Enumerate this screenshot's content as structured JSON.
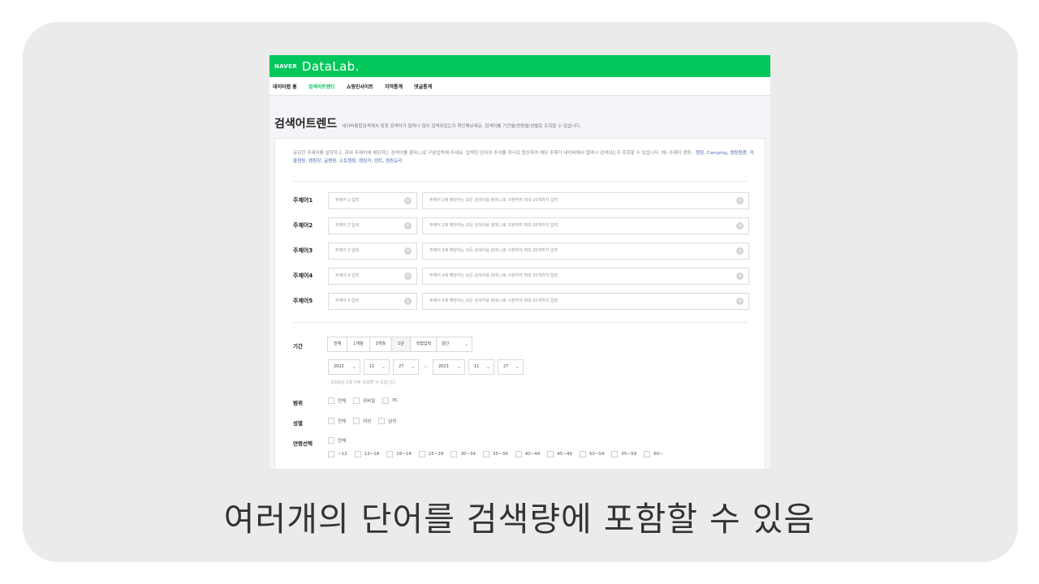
{
  "header": {
    "naver": "NAVER",
    "datalab": "DataLab."
  },
  "nav": [
    {
      "label": "데이터랩 홈"
    },
    {
      "label": "검색어트렌드"
    },
    {
      "label": "쇼핑인사이트"
    },
    {
      "label": "지역통계"
    },
    {
      "label": "댓글통계"
    }
  ],
  "page": {
    "title": "검색어트렌드",
    "desc": "네이버통합검색에서 특정 검색어가 얼마나 많이 검색되었는지 확인해보세요. 검색어를 기간별/연령별/성별로 조회할 수 있습니다.",
    "intro": "궁금한 주제어를 설정하고, 하위 주제어에 해당하는 검색어를 콤마(,)로 구분입력해 주세요. 입력한 단어의 추이를 하나로 합산하여 해당 주제가 네이버에서 얼마나 검색되는지 조회할 수 있습니다. 예) 주제어 캠핑 :",
    "intro_example": "캠핑, Camping, 캠핑용품, 겨울캠핑, 캠핑장, 글램핑, 오토캠핑, 캠핑카, 텐트, 캠핑요리"
  },
  "keywords": [
    {
      "label": "주제어1",
      "placeholder": "주제어 1 입력",
      "sub_placeholder": "주제어 1에 해당하는 모든 검색어를 컴마(,)로 구분하여 최대 20개까지 입력"
    },
    {
      "label": "주제어2",
      "placeholder": "주제어 2 입력",
      "sub_placeholder": "주제어 2에 해당하는 모든 검색어를 컴마(,)로 구분하여 최대 20개까지 입력"
    },
    {
      "label": "주제어3",
      "placeholder": "주제어 3 입력",
      "sub_placeholder": "주제어 3에 해당하는 모든 검색어를 컴마(,)로 구분하여 최대 20개까지 입력"
    },
    {
      "label": "주제어4",
      "placeholder": "주제어 4 입력",
      "sub_placeholder": "주제어 4에 해당하는 모든 검색어를 컴마(,)로 구분하여 최대 20개까지 입력"
    },
    {
      "label": "주제어5",
      "placeholder": "주제어 5 입력",
      "sub_placeholder": "주제어 5에 해당하는 모든 검색어를 컴마(,)로 구분하여 최대 20개까지 입력"
    }
  ],
  "period": {
    "label": "기간",
    "buttons": [
      "전체",
      "1개월",
      "3개월",
      "1년",
      "직접입력"
    ],
    "selected": "1년",
    "unit": "일간",
    "start": {
      "year": "2022",
      "month": "11",
      "day": "27"
    },
    "end": {
      "year": "2023",
      "month": "11",
      "day": "27"
    },
    "tilde": "~",
    "note": "- 2016년 1월 이후 조회할 수 있습니다."
  },
  "scope": {
    "label": "범위",
    "options": [
      "전체",
      "모바일",
      "PC"
    ]
  },
  "gender": {
    "label": "성별",
    "options": [
      "전체",
      "여성",
      "남성"
    ]
  },
  "age": {
    "label": "연령선택",
    "all": "전체",
    "options": [
      "~12",
      "13~18",
      "19~24",
      "25~29",
      "30~34",
      "35~39",
      "40~44",
      "45~49",
      "50~54",
      "55~59",
      "60~"
    ]
  },
  "caption": "여러개의 단어를 검색량에 포함할 수 있음"
}
